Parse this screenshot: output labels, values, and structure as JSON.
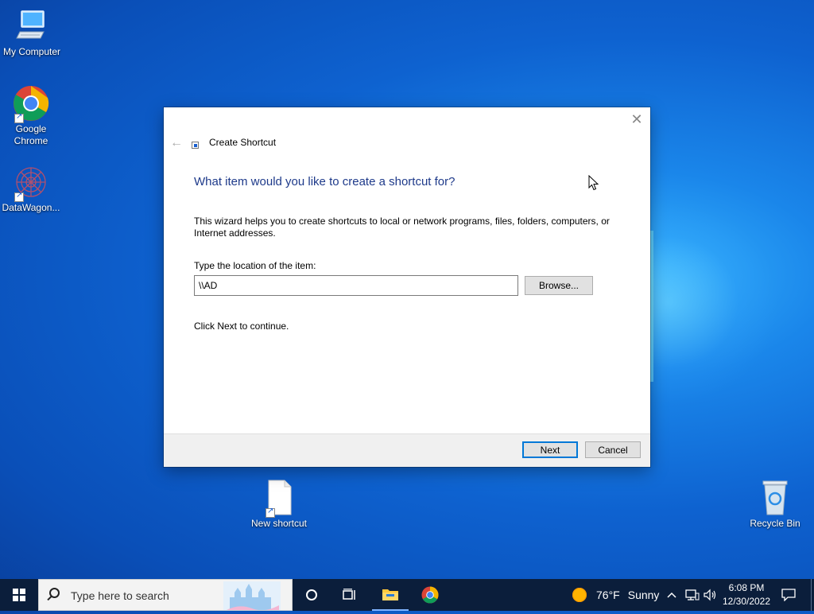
{
  "desktop": {
    "icons": [
      {
        "label": "My Computer"
      },
      {
        "label": "Google Chrome"
      },
      {
        "label": "DataWagon..."
      },
      {
        "label": "New shortcut"
      },
      {
        "label": "Recycle Bin"
      }
    ]
  },
  "dialog": {
    "title": "Create Shortcut",
    "heading": "What item would you like to create a shortcut for?",
    "description": "This wizard helps you to create shortcuts to local or network programs, files, folders, computers, or Internet addresses.",
    "location_label": "Type the location of the item:",
    "location_value": "\\\\AD",
    "browse_label": "Browse...",
    "hint": "Click Next to continue.",
    "next_label": "Next",
    "cancel_label": "Cancel",
    "close_glyph": "✕",
    "back_glyph": "←"
  },
  "taskbar": {
    "search_placeholder": "Type here to search",
    "weather_temp": "76°F",
    "weather_desc": "Sunny",
    "time": "6:08 PM",
    "date": "12/30/2022",
    "tray_chevron": "^"
  },
  "colors": {
    "accent": "#0078d7",
    "heading": "#1e3a8a",
    "taskbar": "#0b1e3b"
  }
}
